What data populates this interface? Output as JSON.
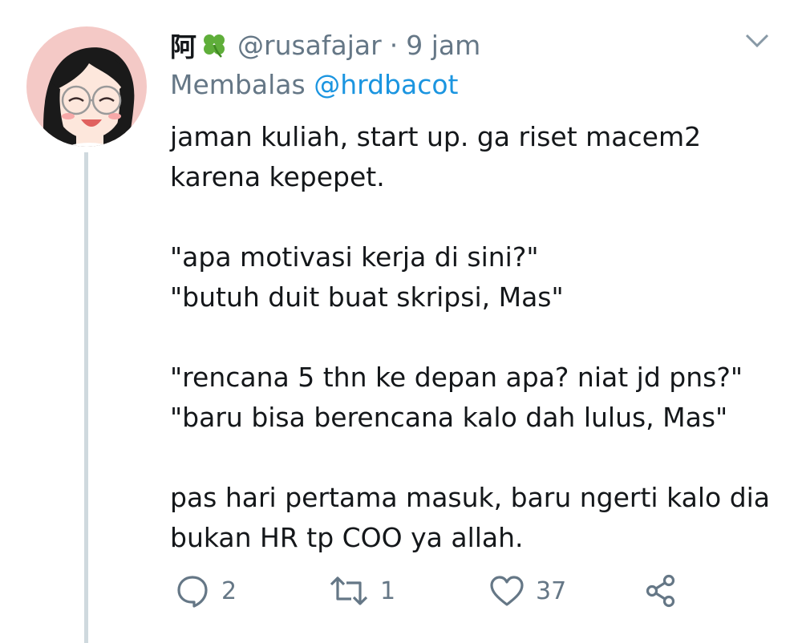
{
  "tweet": {
    "display_name": "阿",
    "display_emoji_icon": "four-leaf-clover-icon",
    "handle": "@rusafajar",
    "separator": "·",
    "time": "9 jam",
    "reply_prefix": "Membalas",
    "reply_to": "@hrdbacot",
    "paragraphs": [
      "jaman kuliah, start up. ga riset macem2\nkarena kepepet.",
      "\"apa motivasi kerja di sini?\"\n\"butuh duit buat skripsi, Mas\"",
      "\"rencana 5 thn ke depan apa? niat jd pns?\"\n\"baru bisa berencana kalo dah lulus, Mas\"",
      "pas hari pertama masuk, baru ngerti kalo dia\nbukan HR tp COO ya allah."
    ]
  },
  "actions": {
    "reply": {
      "icon": "reply-icon",
      "count": "2"
    },
    "retweet": {
      "icon": "retweet-icon",
      "count": "1"
    },
    "like": {
      "icon": "heart-icon",
      "count": "37"
    },
    "share": {
      "icon": "share-icon"
    }
  },
  "colors": {
    "text": "#14171a",
    "muted": "#657786",
    "link": "#1b95e0",
    "thread_line": "#cfd9de",
    "avatar_bg": "#f4c9c6"
  }
}
